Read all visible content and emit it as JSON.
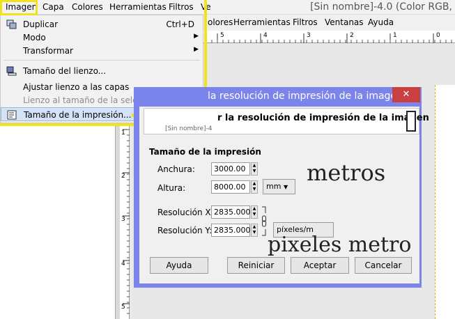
{
  "main_menubar": {
    "items": [
      "Imagen",
      "Capa",
      "Colores",
      "Herramientas",
      "Filtros",
      "Ve"
    ],
    "title": "[Sin nombre]-4.0 (Color RGB,"
  },
  "second_menubar": {
    "items": [
      "olores",
      "Herramientas",
      "Filtros",
      "Ventanas",
      "Ayuda"
    ]
  },
  "ruler_top": {
    "labels": [
      "5",
      "4",
      "3",
      "2",
      "1",
      "0"
    ]
  },
  "ruler_left": {
    "labels": [
      "1",
      "2",
      "3",
      "4",
      "5"
    ]
  },
  "image_menu": {
    "items": [
      {
        "label": "Duplicar",
        "shortcut": "Ctrl+D",
        "icon": "duplicate-icon"
      },
      {
        "label": "Modo",
        "submenu": true
      },
      {
        "label": "Transformar",
        "submenu": true
      },
      {
        "label": "Tamaño del lienzo...",
        "icon": "canvas-size-icon"
      },
      {
        "label": "Ajustar lienzo a las capas"
      },
      {
        "label": "Lienzo al tamaño de la selección",
        "disabled": true
      },
      {
        "label": "Tamaño de la impresión...",
        "icon": "print-size-icon",
        "highlighted": true
      }
    ]
  },
  "dialog": {
    "title": "la resolución de impresión de la imagen",
    "close_symbol": "✕",
    "header": "r la resolución de impresión de la imagen",
    "header_sub": "[Sin nombre]-4",
    "section_label": "Tamaño de la impresión",
    "width_label": "Anchura:",
    "width_value": "3000.00",
    "height_label": "Altura:",
    "height_value": "8000.00",
    "size_unit": "mm",
    "res_x_label": "Resolución X:",
    "res_x_value": "2835.000",
    "res_y_label": "Resolución Y:",
    "res_y_value": "2835.000",
    "res_unit": "píxeles/m",
    "buttons": {
      "help": "Ayuda",
      "reset": "Reiniciar",
      "ok": "Aceptar",
      "cancel": "Cancelar"
    }
  },
  "annotations": {
    "metros": "metros",
    "pixeles_metro": "pixeles metro"
  },
  "colors": {
    "highlight_yellow": "#f2e21e",
    "dialog_frame": "#7b84ea",
    "close_red": "#c94040"
  }
}
